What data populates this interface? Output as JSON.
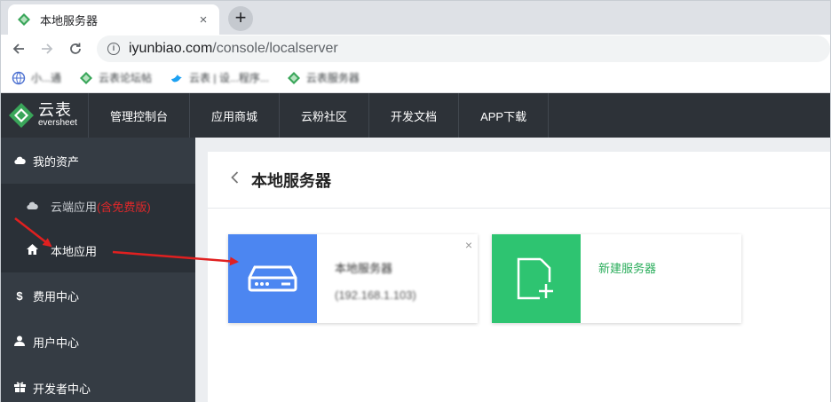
{
  "browser": {
    "tab_title": "本地服务器",
    "tab_close": "×",
    "new_tab": "+",
    "url_host": "iyunbiao.com",
    "url_path": "/console/localserver",
    "bookmarks": [
      {
        "label": "小...通",
        "icon": "globe-icon"
      },
      {
        "label": "云表论坛帖",
        "icon": "eversheet-icon"
      },
      {
        "label": "云表 | 设...程序...",
        "icon": "bird-icon"
      },
      {
        "label": "云表服务器",
        "icon": "eversheet-icon"
      }
    ]
  },
  "app": {
    "logo_cn": "云表",
    "logo_en": "eversheet",
    "nav": [
      "管理控制台",
      "应用商城",
      "云粉社区",
      "开发文档",
      "APP下载"
    ],
    "sidebar": {
      "assets": "我的资产",
      "cloud_app": "云端应用",
      "cloud_app_tag": "(含免费版)",
      "local_app": "本地应用",
      "billing": "费用中心",
      "users": "用户中心",
      "developer": "开发者中心"
    },
    "page_title": "本地服务器",
    "cards": {
      "server_name": "本地服务器",
      "server_sub": "(192.168.1.103)",
      "close": "×",
      "new_server": "新建服务器"
    }
  },
  "colors": {
    "header_bg": "#2d3238",
    "sidebar_bg": "#353c44",
    "server_blue": "#4c86f1",
    "new_green": "#2ec471",
    "accent_red": "#e0282a",
    "annotation_red": "#e02020"
  }
}
